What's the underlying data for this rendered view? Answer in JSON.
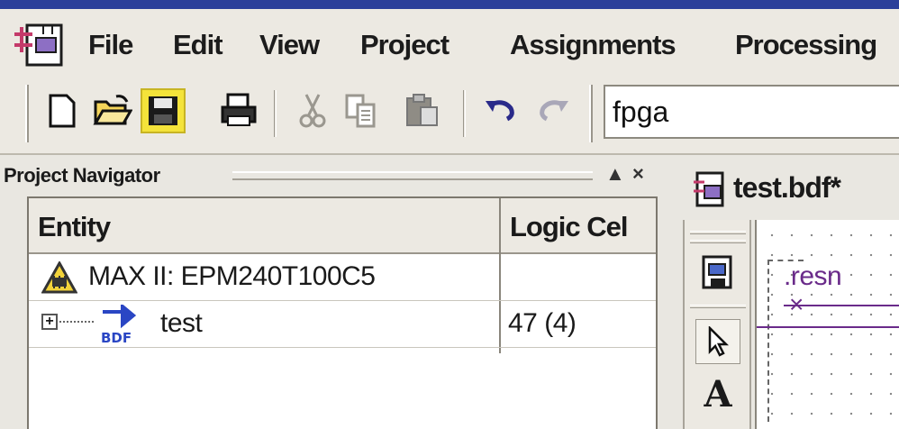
{
  "menubar": {
    "items": [
      "File",
      "Edit",
      "View",
      "Project",
      "Assignments",
      "Processing"
    ]
  },
  "toolbar": {
    "icons": [
      "new-file-icon",
      "open-folder-icon",
      "save-icon",
      "print-icon",
      "cut-icon",
      "copy-icon",
      "paste-icon",
      "undo-icon",
      "redo-icon"
    ],
    "project_combo_value": "fpga"
  },
  "navigator": {
    "title": "Project Navigator",
    "collapse_glyph": "▲",
    "close_glyph": "×",
    "columns": [
      "Entity",
      "Logic Cel"
    ],
    "rows": [
      {
        "icon": "warning-chip-icon",
        "entity": "MAX II: EPM240T100C5",
        "logic_cells": ""
      },
      {
        "icon": "bdf-file-icon",
        "expand": "+",
        "entity": "test",
        "logic_cells": "47 (4)"
      }
    ]
  },
  "editor": {
    "tab_title": "test.bdf*",
    "canvas_label": ".resn",
    "vtools": [
      "block-tool-icon",
      "pointer-icon",
      "text-tool-icon"
    ],
    "text_tool_glyph": "A"
  },
  "colors": {
    "title_strip": "#2b3f9a",
    "save_highlight": "#f4e33a",
    "canvas_label": "#6a2b8a"
  }
}
